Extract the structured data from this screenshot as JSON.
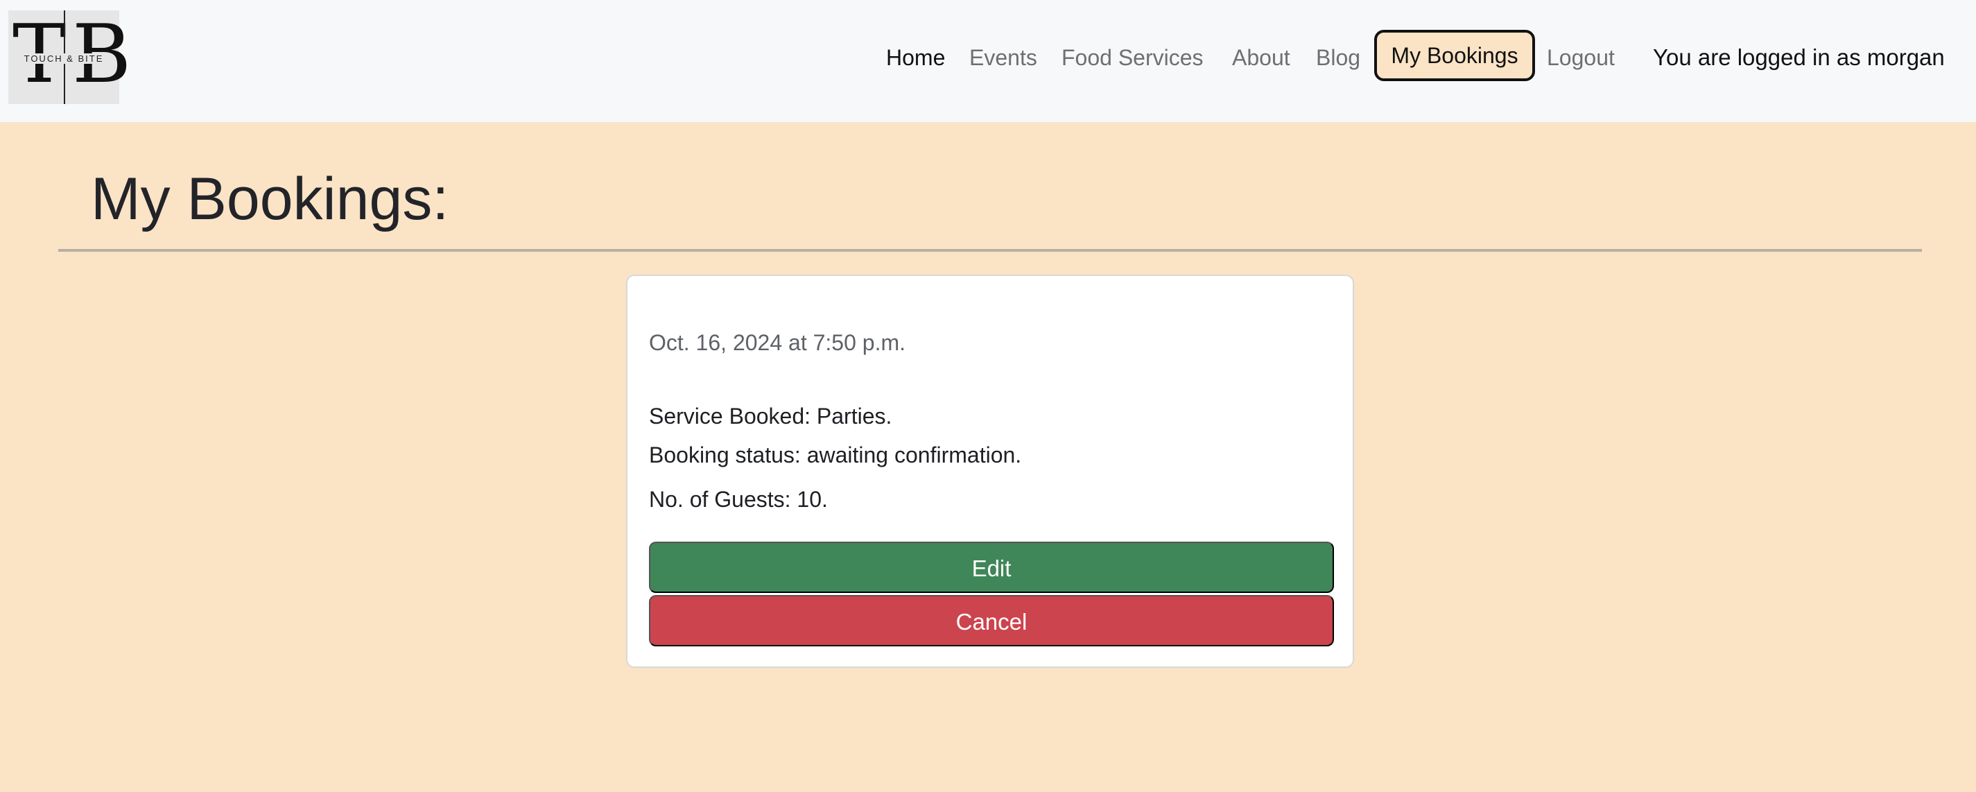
{
  "logo": {
    "letter_left": "T",
    "letter_right": "B",
    "tagline": "TOUCH & BITE"
  },
  "nav": {
    "links": [
      {
        "label": "Home",
        "active": true
      },
      {
        "label": "Events"
      },
      {
        "label": "Food Services"
      },
      {
        "label": "About"
      },
      {
        "label": "Blog"
      },
      {
        "label": "My Bookings",
        "highlighted": true
      },
      {
        "label": "Logout"
      }
    ],
    "login_status": "You are logged in as morgan"
  },
  "page": {
    "title": "My Bookings:"
  },
  "booking": {
    "date": "Oct. 16, 2024 at 7:50 p.m.",
    "service": "Service Booked: Parties.",
    "status": "Booking status: awaiting confirmation.",
    "guests": "No. of Guests: 10.",
    "edit_label": "Edit",
    "cancel_label": "Cancel"
  },
  "colors": {
    "page_background": "#fbe3c6",
    "navbar_background": "#f7f8fa",
    "edit_button": "#3f8659",
    "cancel_button": "#cc444d"
  }
}
